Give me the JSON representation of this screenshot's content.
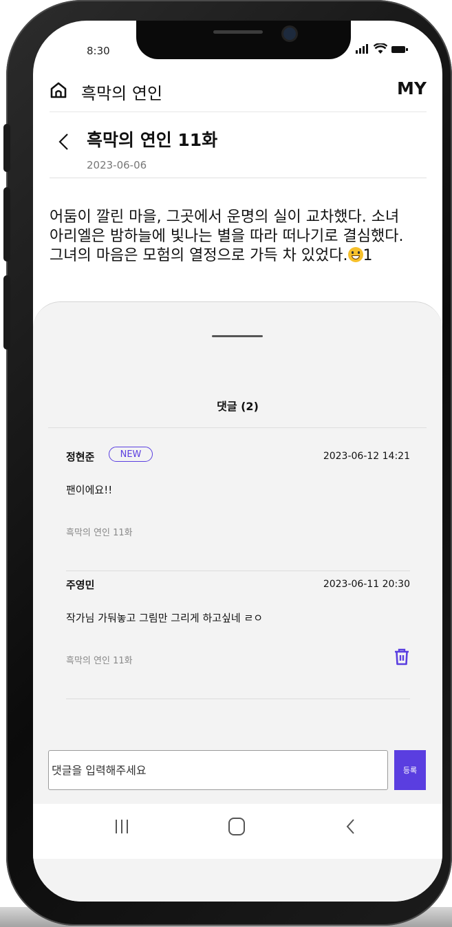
{
  "status_bar": {
    "time": "8:30"
  },
  "header": {
    "title": "흑막의 연인",
    "my_label": "MY"
  },
  "episode": {
    "title": "흑막의 연인 11화",
    "date": "2023-06-06",
    "body": "어둠이 깔린 마을, 그곳에서 운명의 실이 교차했다. 소녀 아리엘은 밤하늘에 빛나는 별을 따라 떠나기로 결심했다. 그녀의 마음은 모험의 열정으로 가득 차 있었다.",
    "reaction_count": "1"
  },
  "comments_section": {
    "heading": "댓글 (2)",
    "comments": [
      {
        "author": "정현준",
        "badge": "NEW",
        "datetime": "2023-06-12 14:21",
        "text": "팬이에요!!",
        "episode": "흑막의 연인 11화"
      },
      {
        "author": "주영민",
        "datetime": "2023-06-11 20:30",
        "text": "작가님 가둬놓고 그림만 그리게 하고싶네 ㄹㅇ",
        "episode": "흑막의 연인 11화"
      }
    ]
  },
  "comment_input": {
    "placeholder": "댓글을 입력해주세요",
    "submit_label": "등록"
  },
  "colors": {
    "accent": "#5a3ee0"
  }
}
